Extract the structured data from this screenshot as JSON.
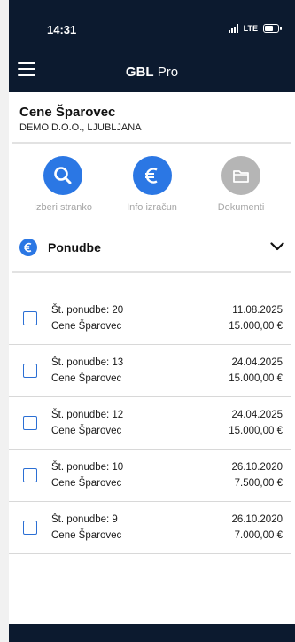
{
  "status": {
    "time": "14:31",
    "network": "LTE"
  },
  "appbar": {
    "title_bold": "GBL",
    "title_rest": " Pro"
  },
  "client": {
    "name": "Cene Šparovec",
    "company": "DEMO D.O.O., LJUBLJANA"
  },
  "actions": [
    {
      "label": "Izberi stranko",
      "icon": "search-icon",
      "color": "#2b77e4"
    },
    {
      "label": "Info izračun",
      "icon": "euro-icon",
      "color": "#2b77e4"
    },
    {
      "label": "Dokumenti",
      "icon": "folder-icon",
      "color": "#b5b5b5"
    }
  ],
  "section": {
    "title": "Ponudbe",
    "icon": "euro-icon",
    "chevron": "chevron-down-icon"
  },
  "offers": [
    {
      "number": "Št. ponudbe: 20",
      "client": "Cene Šparovec",
      "date": "11.08.2025",
      "amount": "15.000,00 €"
    },
    {
      "number": "Št. ponudbe: 13",
      "client": "Cene Šparovec",
      "date": "24.04.2025",
      "amount": "15.000,00 €"
    },
    {
      "number": "Št. ponudbe: 12",
      "client": "Cene Šparovec",
      "date": "24.04.2025",
      "amount": "15.000,00 €"
    },
    {
      "number": "Št. ponudbe: 10",
      "client": "Cene Šparovec",
      "date": "26.10.2020",
      "amount": "7.500,00 €"
    },
    {
      "number": "Št. ponudbe: 9",
      "client": "Cene Šparovec",
      "date": "26.10.2020",
      "amount": "7.000,00 €"
    }
  ],
  "colors": {
    "navy": "#0c1a2f",
    "accent": "#2b77e4",
    "disabled": "#b5b5b5"
  }
}
